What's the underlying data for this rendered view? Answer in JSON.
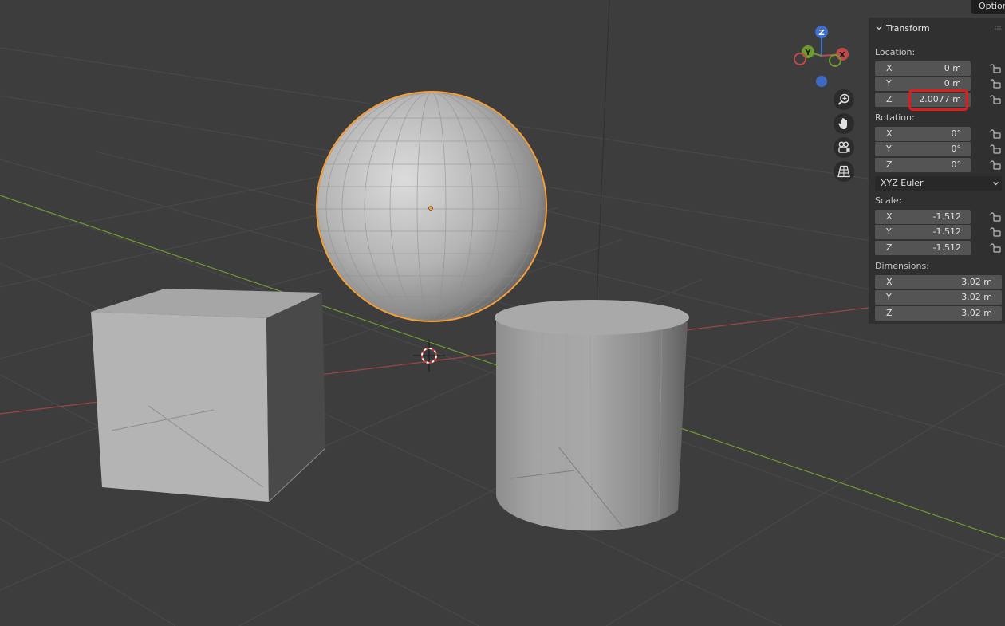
{
  "header": {
    "options_label": "Options"
  },
  "gizmo": {
    "z_label": "Z",
    "y_label": "Y",
    "x_label": "X"
  },
  "panel": {
    "title": "Transform",
    "location": {
      "label": "Location:",
      "rows": [
        {
          "axis": "X",
          "value": "0 m"
        },
        {
          "axis": "Y",
          "value": "0 m"
        },
        {
          "axis": "Z",
          "value": "2.0077 m"
        }
      ]
    },
    "rotation": {
      "label": "Rotation:",
      "rows": [
        {
          "axis": "X",
          "value": "0°"
        },
        {
          "axis": "Y",
          "value": "0°"
        },
        {
          "axis": "Z",
          "value": "0°"
        }
      ],
      "mode": "XYZ Euler"
    },
    "scale": {
      "label": "Scale:",
      "rows": [
        {
          "axis": "X",
          "value": "-1.512"
        },
        {
          "axis": "Y",
          "value": "-1.512"
        },
        {
          "axis": "Z",
          "value": "-1.512"
        }
      ]
    },
    "dimensions": {
      "label": "Dimensions:",
      "rows": [
        {
          "axis": "X",
          "value": "3.02 m"
        },
        {
          "axis": "Y",
          "value": "3.02 m"
        },
        {
          "axis": "Z",
          "value": "3.02 m"
        }
      ]
    }
  },
  "colors": {
    "selection_outline": "#f5a03a",
    "highlight": "#e01c1c",
    "axis_x": "#c04a4a",
    "axis_y": "#6f9a2e",
    "axis_z": "#3f6fd0"
  }
}
